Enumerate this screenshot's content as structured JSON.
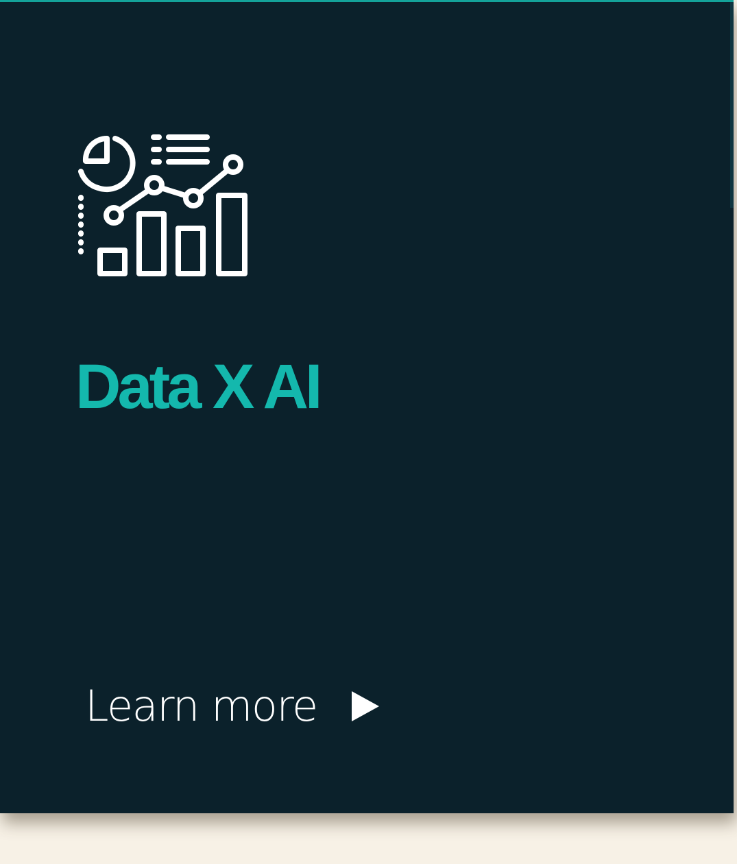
{
  "card": {
    "title": "Data X AI",
    "cta_label": "Learn more",
    "icon": "analytics-dashboard-icon",
    "cta_icon": "play-arrow-icon"
  },
  "colors": {
    "page_background": "#f7f1e6",
    "card_background": "#0b212b",
    "accent": "#14b8ad",
    "text": "#ffffff"
  }
}
